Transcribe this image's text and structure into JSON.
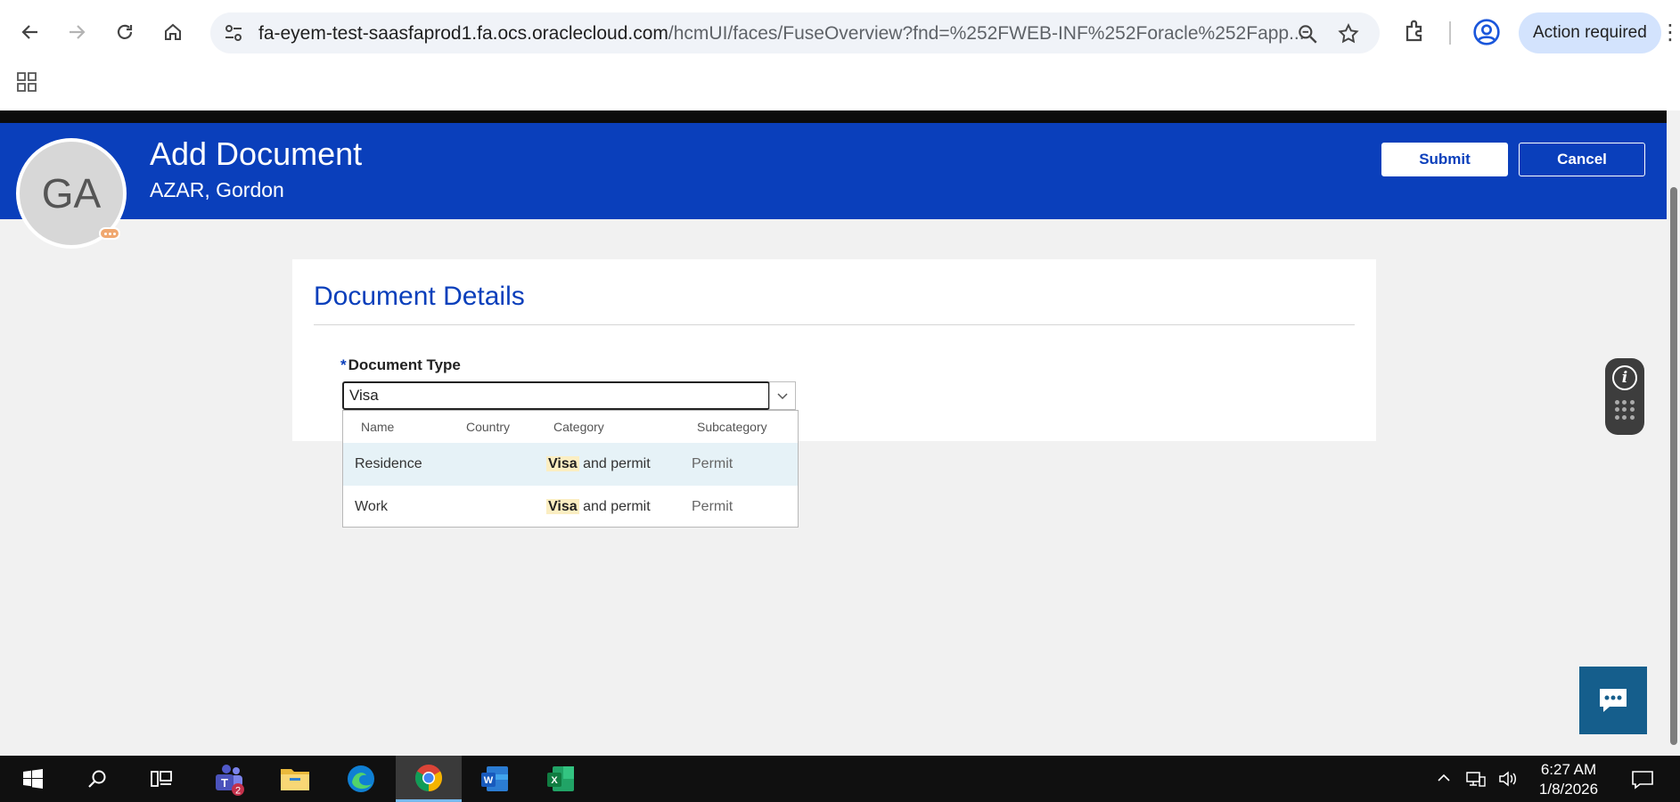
{
  "browser": {
    "url_host": "fa-eyem-test-saasfaprod1.fa.ocs.oraclecloud.com",
    "url_path": "/hcmUI/faces/FuseOverview?fnd=%252FWEB-INF%252Foracle%252Fapp...",
    "action_required": "Action required"
  },
  "header": {
    "avatar_initials": "GA",
    "title": "Add Document",
    "subtitle": "AZAR, Gordon",
    "submit_label": "Submit",
    "cancel_label": "Cancel"
  },
  "section": {
    "title": "Document Details",
    "field_required_marker": "*",
    "field_label": "Document Type",
    "field_value": "Visa"
  },
  "suggestions": {
    "columns": [
      "Name",
      "Country",
      "Category",
      "Subcategory"
    ],
    "rows": [
      {
        "name": "Residence",
        "country": "",
        "category_match": "Visa",
        "category_rest": " and permit",
        "subcategory": "Permit"
      },
      {
        "name": "Work",
        "country": "",
        "category_match": "Visa",
        "category_rest": " and permit",
        "subcategory": "Permit"
      }
    ]
  },
  "taskbar": {
    "teams_badge": "2",
    "time": "6:27 AM",
    "date": "1/8/2026"
  },
  "colors": {
    "brand_blue": "#0a3fbb",
    "highlight": "#fbeec2",
    "chat_button": "#155e8c"
  }
}
